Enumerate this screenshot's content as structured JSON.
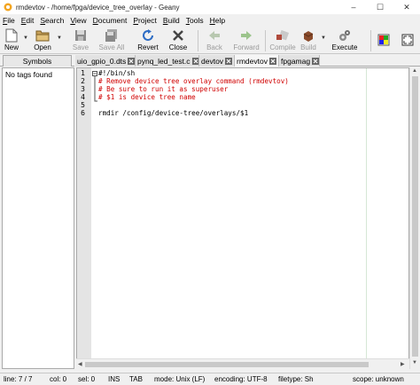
{
  "window": {
    "title": "rmdevtov - /home/fpga/device_tree_overlay - Geany",
    "controls": {
      "minimize": "–",
      "maximize": "☐",
      "close": "✕"
    }
  },
  "menu": [
    {
      "prefix": "",
      "key": "F",
      "rest": "ile"
    },
    {
      "prefix": "",
      "key": "E",
      "rest": "dit"
    },
    {
      "prefix": "",
      "key": "S",
      "rest": "earch"
    },
    {
      "prefix": "",
      "key": "V",
      "rest": "iew"
    },
    {
      "prefix": "",
      "key": "D",
      "rest": "ocument"
    },
    {
      "prefix": "",
      "key": "P",
      "rest": "roject"
    },
    {
      "prefix": "",
      "key": "B",
      "rest": "uild"
    },
    {
      "prefix": "",
      "key": "T",
      "rest": "ools"
    },
    {
      "prefix": "",
      "key": "H",
      "rest": "elp"
    }
  ],
  "toolbar": {
    "new": "New",
    "open": "Open",
    "save": "Save",
    "save_all": "Save All",
    "revert": "Revert",
    "close": "Close",
    "back": "Back",
    "forward": "Forward",
    "compile": "Compile",
    "build": "Build",
    "execute": "Execute"
  },
  "sidebar": {
    "tab": "Symbols",
    "empty": "No tags found"
  },
  "tabs": [
    {
      "label": "uio_gpio_0.dts"
    },
    {
      "label": "pynq_led_test.c"
    },
    {
      "label": "devtov"
    },
    {
      "label": "rmdevtov"
    },
    {
      "label": "fpgamag"
    }
  ],
  "editor": {
    "line_numbers": [
      "1",
      "2",
      "3",
      "4",
      "5",
      "6"
    ],
    "lines": [
      "#!/bin/sh",
      "# Remove device tree overlay command (rmdevtov)",
      "# Be sure to run it as superuser",
      "# $1 is device tree name",
      "",
      "rmdir /config/device-tree/overlays/$1"
    ]
  },
  "status": {
    "line": "line: 7 / 7",
    "col": "col: 0",
    "sel": "sel: 0",
    "ins": "INS",
    "tab": "TAB",
    "mode": "mode: Unix (LF)",
    "encoding": "encoding: UTF-8",
    "filetype": "filetype: Sh",
    "scope": "scope: unknown"
  }
}
